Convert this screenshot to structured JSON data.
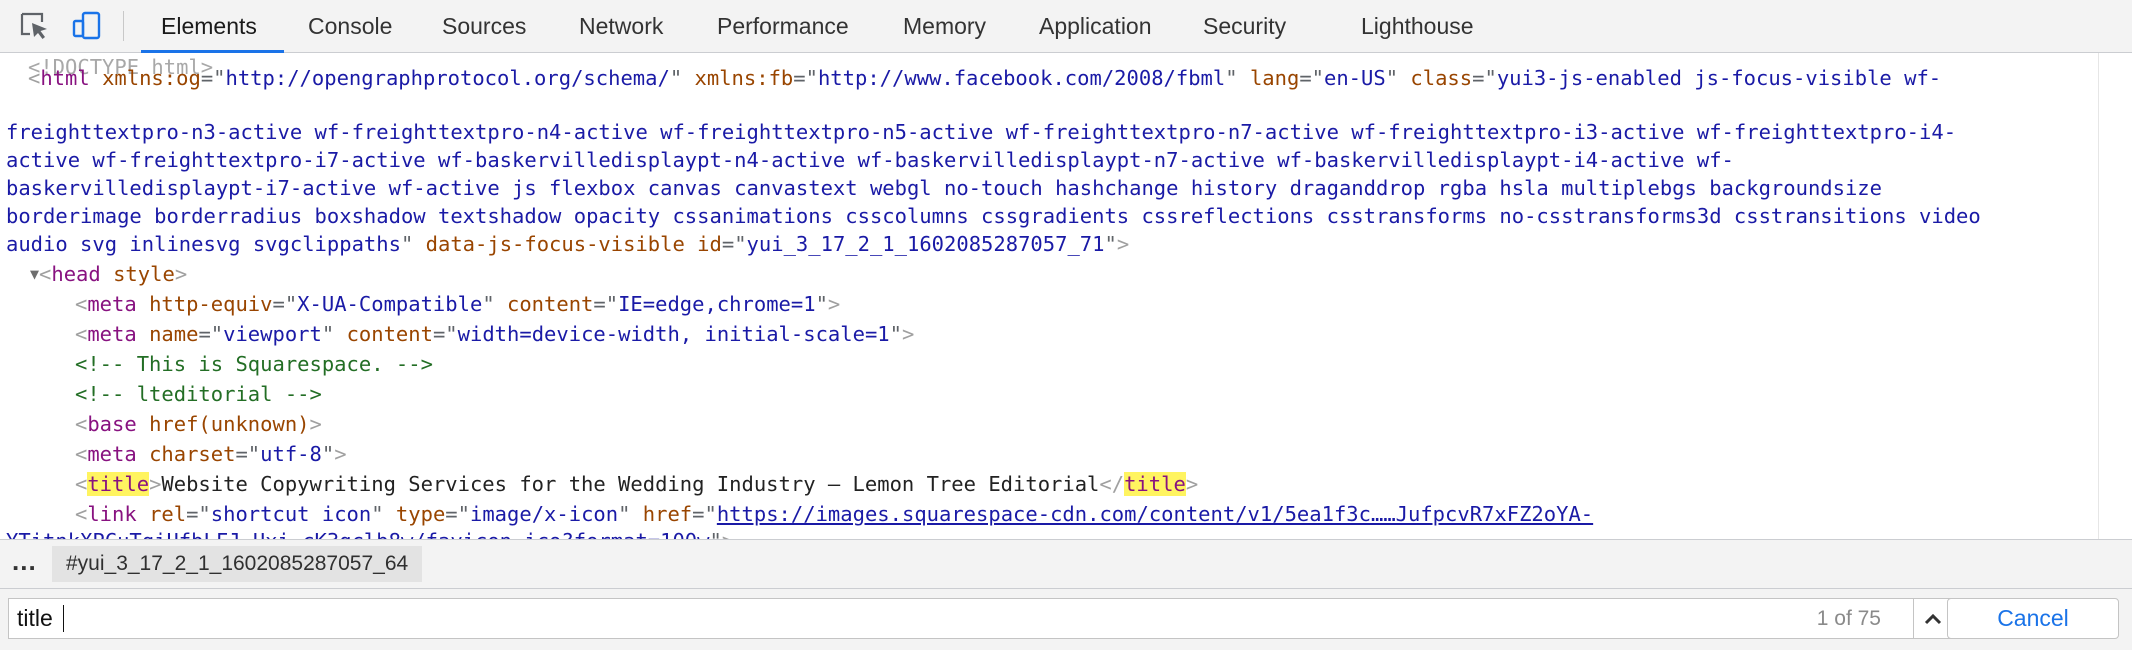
{
  "toolbar": {
    "icons": {
      "inspect": "inspect-element-icon",
      "device": "device-toolbar-icon"
    },
    "tabs": [
      {
        "label": "Elements",
        "active": true
      },
      {
        "label": "Console"
      },
      {
        "label": "Sources"
      },
      {
        "label": "Network"
      },
      {
        "label": "Performance"
      },
      {
        "label": "Memory"
      },
      {
        "label": "Application"
      },
      {
        "label": "Security"
      },
      {
        "label": "Lighthouse"
      }
    ],
    "accent": "#1a73e8"
  },
  "dom": {
    "doctype": "<!DOCTYPE html>",
    "html": {
      "tag": "html",
      "attrs": [
        {
          "name": "xmlns:og",
          "value": "http://opengraphprotocol.org/schema/"
        },
        {
          "name": "xmlns:fb",
          "value": "http://www.facebook.com/2008/fbml"
        },
        {
          "name": "lang",
          "value": "en-US"
        },
        {
          "name": "class",
          "value_lines": [
            "yui3-js-enabled js-focus-visible wf-",
            "freighttextpro-n3-active wf-freighttextpro-n4-active wf-freighttextpro-n5-active wf-freighttextpro-n7-active wf-freighttextpro-i3-active wf-freighttextpro-i4-",
            "active wf-freighttextpro-i7-active wf-baskervilledisplaypt-n4-active wf-baskervilledisplaypt-n7-active wf-baskervilledisplaypt-i4-active wf-",
            "baskervilledisplaypt-i7-active wf-active js flexbox canvas canvastext webgl no-touch hashchange history draganddrop rgba hsla multiplebgs backgroundsize",
            "borderimage borderradius boxshadow textshadow opacity cssanimations csscolumns cssgradients cssreflections csstransforms no-csstransforms3d csstransitions video",
            "audio svg inlinesvg svgclippaths"
          ]
        },
        {
          "name": "data-js-focus-visible"
        },
        {
          "name": "id",
          "value": "yui_3_17_2_1_1602085287057_71"
        }
      ]
    },
    "head": {
      "tag": "head",
      "attr": "style"
    },
    "meta1": {
      "tag": "meta",
      "a1": "http-equiv",
      "v1": "X-UA-Compatible",
      "a2": "content",
      "v2": "IE=edge,chrome=1"
    },
    "meta2": {
      "tag": "meta",
      "a1": "name",
      "v1": "viewport",
      "a2": "content",
      "v2": "width=device-width, initial-scale=1"
    },
    "comment1": "<!-- This is Squarespace. -->",
    "comment2": "<!-- lteditorial -->",
    "base": {
      "tag": "base",
      "attr": "href(unknown)"
    },
    "meta3": {
      "tag": "meta",
      "a1": "charset",
      "v1": "utf-8"
    },
    "title": {
      "tag": "title",
      "text": "Website Copywriting Services for the Wedding Industry — Lemon Tree Editorial"
    },
    "link": {
      "tag": "link",
      "a1": "rel",
      "v1": "shortcut icon",
      "a2": "type",
      "v2": "image/x-icon",
      "a3": "href",
      "href_line1": "https://images.squarespace-cdn.com/content/v1/5ea1f3c……JufpcvR7xFZ2oYA-",
      "href_line2": "YTitnkXPCuTqiUfbLFJ_Uxi_cK3gclb8w/favicon.ico?format=100w"
    },
    "colors": {
      "tag": "#881280",
      "attr_name": "#994500",
      "attr_value": "#1a1aa6",
      "comment": "#236e25",
      "highlight": "#fff460"
    }
  },
  "breadcrumb": {
    "more": "...",
    "item": "#yui_3_17_2_1_1602085287057_64"
  },
  "search": {
    "value": "title",
    "count": "1 of 75",
    "cancel": "Cancel"
  }
}
